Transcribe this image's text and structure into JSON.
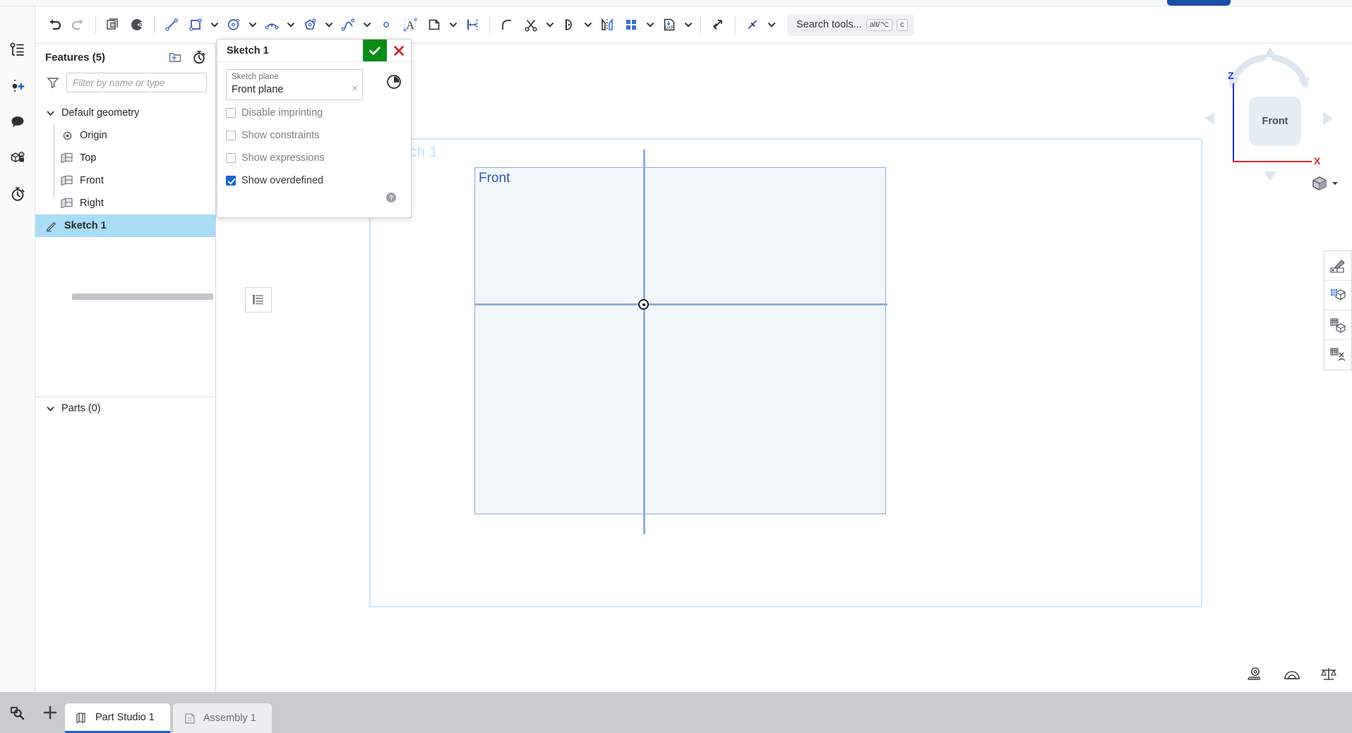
{
  "toolbar": {
    "tools": [
      {
        "name": "undo-icon",
        "label": "Undo"
      },
      {
        "name": "redo-icon",
        "label": "Redo"
      },
      {
        "name": "copy-sketch-icon",
        "label": "Copy"
      },
      {
        "name": "sketch-mirror-icon",
        "label": "Mirror"
      },
      {
        "name": "line-tool-icon",
        "label": "Line"
      },
      {
        "name": "rectangle-tool-icon",
        "label": "Rectangle"
      },
      {
        "name": "circle-tool-icon",
        "label": "Circle"
      },
      {
        "name": "arc-tool-icon",
        "label": "Arc"
      },
      {
        "name": "polygon-tool-icon",
        "label": "Polygon"
      },
      {
        "name": "spline-tool-icon",
        "label": "Spline"
      },
      {
        "name": "point-tool-icon",
        "label": "Point"
      },
      {
        "name": "text-tool-icon",
        "label": "Text"
      },
      {
        "name": "offset-tool-icon",
        "label": "Offset"
      },
      {
        "name": "dimension-tool-icon",
        "label": "Dimension"
      },
      {
        "name": "fillet-tool-icon",
        "label": "Fillet"
      },
      {
        "name": "trim-tool-icon",
        "label": "Trim"
      },
      {
        "name": "extend-tool-icon",
        "label": "Extend"
      },
      {
        "name": "mirror-tool-icon",
        "label": "Mirror"
      },
      {
        "name": "pattern-tool-icon",
        "label": "Pattern"
      },
      {
        "name": "dxf-import-icon",
        "label": "Import DXF"
      },
      {
        "name": "transform-tool-icon",
        "label": "Transform"
      },
      {
        "name": "construction-tool-icon",
        "label": "Construction"
      }
    ],
    "search": {
      "placeholder": "Search tools...",
      "key_modifier": "alt/⌥",
      "key_letter": "c"
    }
  },
  "rail": {
    "items": [
      {
        "name": "feature-list-icon",
        "label": "Feature list"
      },
      {
        "name": "add-version-icon",
        "label": "Add version"
      },
      {
        "name": "comments-icon",
        "label": "Comments"
      },
      {
        "name": "part-permissions-icon",
        "label": "Part properties"
      },
      {
        "name": "history-icon",
        "label": "History"
      }
    ]
  },
  "features": {
    "title": "Features (5)",
    "header_icons": [
      {
        "name": "new-folder-icon",
        "label": "New folder"
      },
      {
        "name": "rollback-timer-icon",
        "label": "Rollback"
      }
    ],
    "filter": {
      "placeholder": "Filter by name or type",
      "value": ""
    },
    "tree": [
      {
        "name": "default-geometry",
        "label": "Default geometry",
        "icon": "chevron-down-icon",
        "type": "group"
      },
      {
        "name": "origin",
        "label": "Origin",
        "icon": "origin-icon",
        "type": "child"
      },
      {
        "name": "top-plane",
        "label": "Top",
        "icon": "plane-icon",
        "type": "child"
      },
      {
        "name": "front-plane",
        "label": "Front",
        "icon": "plane-icon",
        "type": "child"
      },
      {
        "name": "right-plane",
        "label": "Right",
        "icon": "plane-icon",
        "type": "child"
      },
      {
        "name": "sketch-1",
        "label": "Sketch 1",
        "icon": "sketch-pencil-icon",
        "type": "feature",
        "selected": true
      }
    ],
    "parts_title": "Parts (0)"
  },
  "dialog": {
    "title": "Sketch 1",
    "accept_label": "Accept",
    "cancel_label": "Cancel",
    "plane_label": "Sketch plane",
    "plane_value": "Front plane",
    "clear_label": "×",
    "history_icon": "sketch-history-icon",
    "help_icon": "help-icon",
    "options": [
      {
        "name": "disable-imprinting",
        "label": "Disable imprinting",
        "checked": false
      },
      {
        "name": "show-constraints",
        "label": "Show constraints",
        "checked": false
      },
      {
        "name": "show-expressions",
        "label": "Show expressions",
        "checked": false
      },
      {
        "name": "show-overdefined",
        "label": "Show overdefined",
        "checked": true
      }
    ]
  },
  "canvas": {
    "watermark": "Sketch 1",
    "plane_name": "Front",
    "panel_toggle_icon": "sketch-panel-icon",
    "origin_name": "sketch-origin-point"
  },
  "viewcube": {
    "face_label": "Front",
    "axis_z": "Z",
    "axis_x": "X",
    "view_mode_icon": "shaded-view-icon"
  },
  "right_tools": [
    {
      "name": "appearance-tool-icon",
      "label": "Appearance"
    },
    {
      "name": "display-state-icon",
      "label": "Display state"
    },
    {
      "name": "section-view-icon",
      "label": "Section view"
    },
    {
      "name": "explode-view-icon",
      "label": "Explode view"
    }
  ],
  "measure_tools": [
    {
      "name": "measure-tape-icon",
      "label": "Measure"
    },
    {
      "name": "protractor-icon",
      "label": "Angle"
    },
    {
      "name": "mass-properties-icon",
      "label": "Mass properties"
    }
  ],
  "tabbar": {
    "search_icon": "tab-search-icon",
    "add_label": "+",
    "tabs": [
      {
        "name": "tab-part-studio-1",
        "label": "Part Studio 1",
        "icon": "part-studio-icon",
        "active": true
      },
      {
        "name": "tab-assembly-1",
        "label": "Assembly 1",
        "icon": "assembly-icon",
        "active": false
      }
    ]
  },
  "colors": {
    "accent": "#1763cf",
    "accept_green": "#0b8c18",
    "cancel_red": "#d02a2a",
    "selection_blue": "#a9dcf5",
    "axis_z": "#2430e0",
    "axis_x": "#e02424"
  }
}
